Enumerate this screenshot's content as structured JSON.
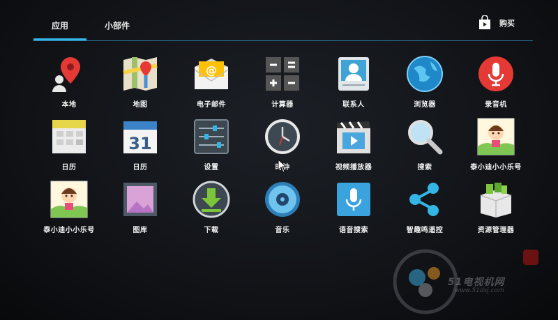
{
  "tabs": {
    "apps": "应用",
    "widgets": "小部件"
  },
  "shop": {
    "label": "购买"
  },
  "apps": [
    {
      "label": "本地",
      "icon": "maps-pin-person-icon"
    },
    {
      "label": "地图",
      "icon": "maps-icon"
    },
    {
      "label": "电子邮件",
      "icon": "email-icon"
    },
    {
      "label": "计算器",
      "icon": "calculator-icon"
    },
    {
      "label": "联系人",
      "icon": "contacts-icon"
    },
    {
      "label": "浏览器",
      "icon": "browser-globe-icon"
    },
    {
      "label": "录音机",
      "icon": "sound-recorder-icon"
    },
    {
      "label": "日历",
      "icon": "calendar-icon"
    },
    {
      "label": "日历",
      "icon": "calendar-31-icon"
    },
    {
      "label": "设置",
      "icon": "settings-icon"
    },
    {
      "label": "时钟",
      "icon": "clock-icon"
    },
    {
      "label": "视频播放器",
      "icon": "video-player-icon"
    },
    {
      "label": "搜索",
      "icon": "search-icon"
    },
    {
      "label": "泰小迪小小乐号",
      "icon": "cartoon-kids-app-icon"
    },
    {
      "label": "泰小迪小小乐号",
      "icon": "cartoon-kids-app-icon"
    },
    {
      "label": "图库",
      "icon": "gallery-icon"
    },
    {
      "label": "下载",
      "icon": "download-icon"
    },
    {
      "label": "音乐",
      "icon": "music-icon"
    },
    {
      "label": "语音搜索",
      "icon": "voice-search-icon"
    },
    {
      "label": "智趣鸣遥控",
      "icon": "share-remote-icon"
    },
    {
      "label": "资源管理器",
      "icon": "file-manager-icon"
    }
  ],
  "watermark": {
    "text": "51电视机网",
    "url": "www.51dsj.com"
  },
  "colors": {
    "accent": "#33b5e5",
    "background": "#121418"
  }
}
